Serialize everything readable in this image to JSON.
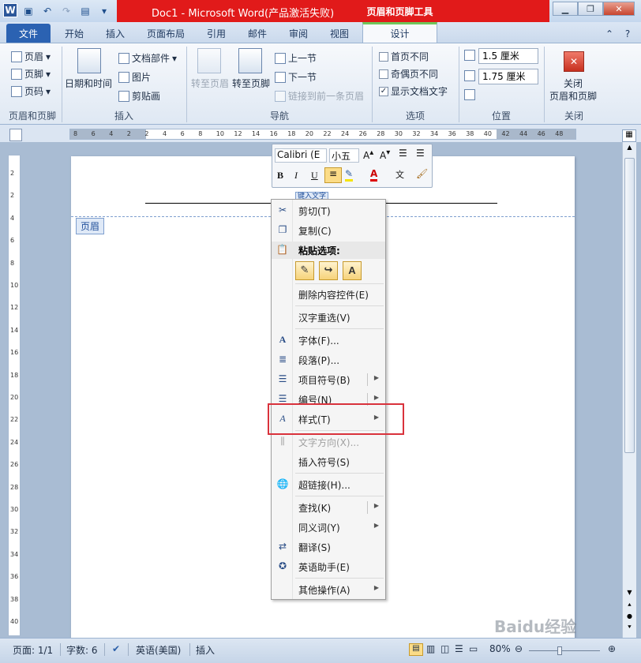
{
  "window": {
    "title": "Doc1 - Microsoft Word(产品激活失败)",
    "context_tab": "页眉和页脚工具"
  },
  "tabs": [
    "文件",
    "开始",
    "插入",
    "页面布局",
    "引用",
    "邮件",
    "审阅",
    "视图",
    "设计"
  ],
  "ribbon": {
    "hf_group": {
      "header": "页眉",
      "footer": "页脚",
      "pagenum": "页码",
      "label": "页眉和页脚"
    },
    "insert_group": {
      "datetime": "日期和时间",
      "docparts": "文档部件",
      "picture": "图片",
      "clipart": "剪贴画",
      "label": "插入"
    },
    "nav_group": {
      "goto_header": "转至页眉",
      "goto_footer": "转至页脚",
      "prev": "上一节",
      "next": "下一节",
      "link_prev": "链接到前一条页眉",
      "label": "导航"
    },
    "options_group": {
      "first_page": "首页不同",
      "odd_even": "奇偶页不同",
      "show_text": "显示文档文字",
      "label": "选项"
    },
    "position_group": {
      "header_pos": "1.5 厘米",
      "footer_pos": "1.75 厘米",
      "label": "位置"
    },
    "close_group": {
      "close": "关闭\n页眉和页脚",
      "close_line1": "关闭",
      "close_line2": "页眉和页脚",
      "label": "关闭"
    }
  },
  "ruler": {
    "h": [
      "8",
      "6",
      "4",
      "2",
      "2",
      "4",
      "6",
      "8",
      "10",
      "12",
      "14",
      "16",
      "18",
      "20",
      "22",
      "24",
      "26",
      "28",
      "30",
      "32",
      "34",
      "36",
      "38",
      "40",
      "42",
      "44",
      "46",
      "48"
    ],
    "v": [
      "2",
      "2",
      "4",
      "6",
      "8",
      "10",
      "12",
      "14",
      "16",
      "18",
      "20",
      "22",
      "24",
      "26",
      "28",
      "30",
      "32",
      "34",
      "36",
      "38",
      "40"
    ]
  },
  "document": {
    "header_tag": "页眉",
    "control_tag": "键入文字"
  },
  "mini_toolbar": {
    "font": "Calibri (E",
    "size": "小五",
    "bold": "B",
    "italic": "I",
    "underline": "U"
  },
  "context_menu": {
    "cut": "剪切(T)",
    "copy": "复制(C)",
    "paste_header": "粘贴选项:",
    "delete_cc": "删除内容控件(E)",
    "reconvert": "汉字重选(V)",
    "font": "字体(F)...",
    "paragraph": "段落(P)...",
    "bullets": "项目符号(B)",
    "numbering": "编号(N)",
    "styles": "样式(T)",
    "text_dir": "文字方向(X)...",
    "insert_symbol": "插入符号(S)",
    "hyperlink": "超链接(H)...",
    "lookup": "查找(K)",
    "synonyms": "同义词(Y)",
    "translate": "翻译(S)",
    "eng_assist": "英语助手(E)",
    "more": "其他操作(A)"
  },
  "status": {
    "page": "页面: 1/1",
    "words": "字数: 6",
    "lang": "英语(美国)",
    "mode": "插入",
    "zoom": "80%"
  },
  "watermark": "Baidu经验"
}
